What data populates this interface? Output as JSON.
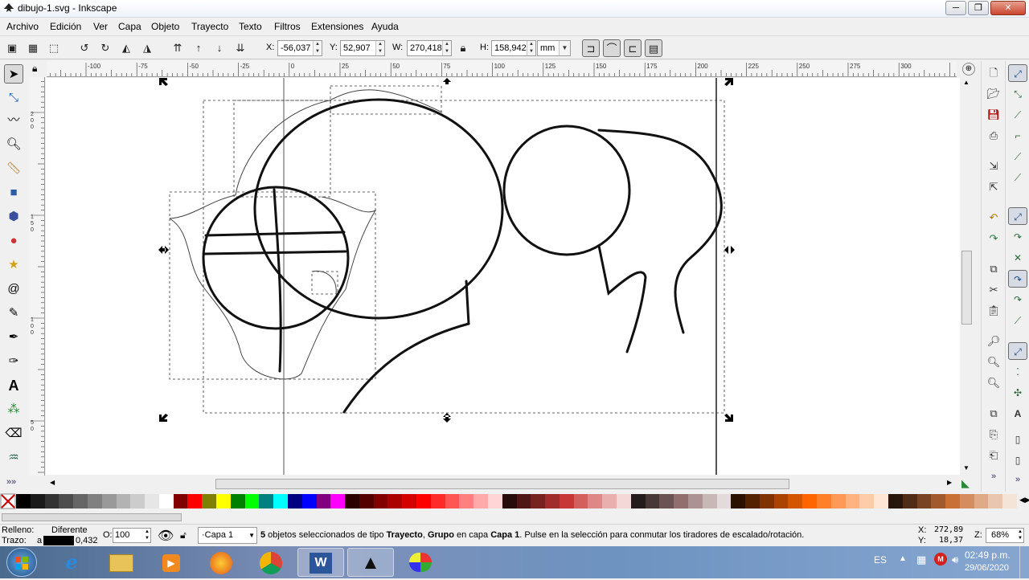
{
  "window": {
    "title": "dibujo-1.svg - Inkscape",
    "minimize": "─",
    "maximize": "❐",
    "close": "✕"
  },
  "menu": [
    "Archivo",
    "Edición",
    "Ver",
    "Capa",
    "Objeto",
    "Trayecto",
    "Texto",
    "Filtros",
    "Extensiones",
    "Ayuda"
  ],
  "toolbar": {
    "x_label": "X:",
    "x_value": "-56,037",
    "y_label": "Y:",
    "y_value": "52,907",
    "w_label": "W:",
    "w_value": "270,418",
    "h_label": "H:",
    "h_value": "158,942",
    "unit": "mm"
  },
  "ruler": {
    "h_labels": [
      "-100",
      "-75",
      "-50",
      "-25",
      "0",
      "25",
      "50",
      "75",
      "100",
      "125",
      "150",
      "175",
      "200",
      "225",
      "250",
      "275",
      "300"
    ],
    "v_labels": [
      "200",
      "150",
      "100",
      "50"
    ]
  },
  "palette": {
    "colors": [
      "#000000",
      "#1a1a1a",
      "#333333",
      "#4d4d4d",
      "#666666",
      "#808080",
      "#999999",
      "#b3b3b3",
      "#cccccc",
      "#e6e6e6",
      "#ffffff",
      "#800000",
      "#ff0000",
      "#808000",
      "#ffff00",
      "#008000",
      "#00ff00",
      "#008080",
      "#00ffff",
      "#000080",
      "#0000ff",
      "#800080",
      "#ff00ff",
      "#2b0000",
      "#550000",
      "#800000",
      "#aa0000",
      "#d40000",
      "#ff0000",
      "#ff2a2a",
      "#ff5555",
      "#ff8080",
      "#ffaaaa",
      "#ffd5d5",
      "#280b0b",
      "#501616",
      "#782121",
      "#a02c2c",
      "#c83737",
      "#d35f5f",
      "#de8787",
      "#e9afaf",
      "#f4d7d7",
      "#241c1c",
      "#483737",
      "#6c5353",
      "#916f6f",
      "#ac9393",
      "#c8b7b7",
      "#e3dbdb",
      "#2b1100",
      "#552200",
      "#803300",
      "#aa4400",
      "#d45500",
      "#ff6600",
      "#ff7f2a",
      "#ff9955",
      "#ffb380",
      "#ffccaa",
      "#ffe6d5",
      "#28170b",
      "#502d16",
      "#784421",
      "#a05a2c",
      "#c87137",
      "#d38d5f",
      "#deaa87",
      "#e9c6af",
      "#f4e3d7"
    ]
  },
  "status": {
    "fill_label": "Relleno:",
    "fill_value": "Diferente",
    "stroke_label": "Trazo:",
    "stroke_prefix": "a",
    "stroke_width": "0,432",
    "opacity_label": "O:",
    "opacity_value": "100",
    "layer": "·Capa 1",
    "message_count": "5",
    "message_a": " objetos seleccionados de tipo ",
    "message_type": "Trayecto",
    "message_sep": ", ",
    "message_type2": "Grupo",
    "message_b": " en capa ",
    "message_layer": "Capa 1",
    "message_c": ". Pulse en la selección para conmutar los tiradores de escalado/rotación.",
    "cursor_x_label": "X:",
    "cursor_x": "272,89",
    "cursor_y_label": "Y:",
    "cursor_y": "18,37",
    "zoom_label": "Z:",
    "zoom_value": "68%"
  },
  "taskbar": {
    "lang": "ES",
    "time": "02:49 p.m.",
    "date": "29/06/2020"
  }
}
